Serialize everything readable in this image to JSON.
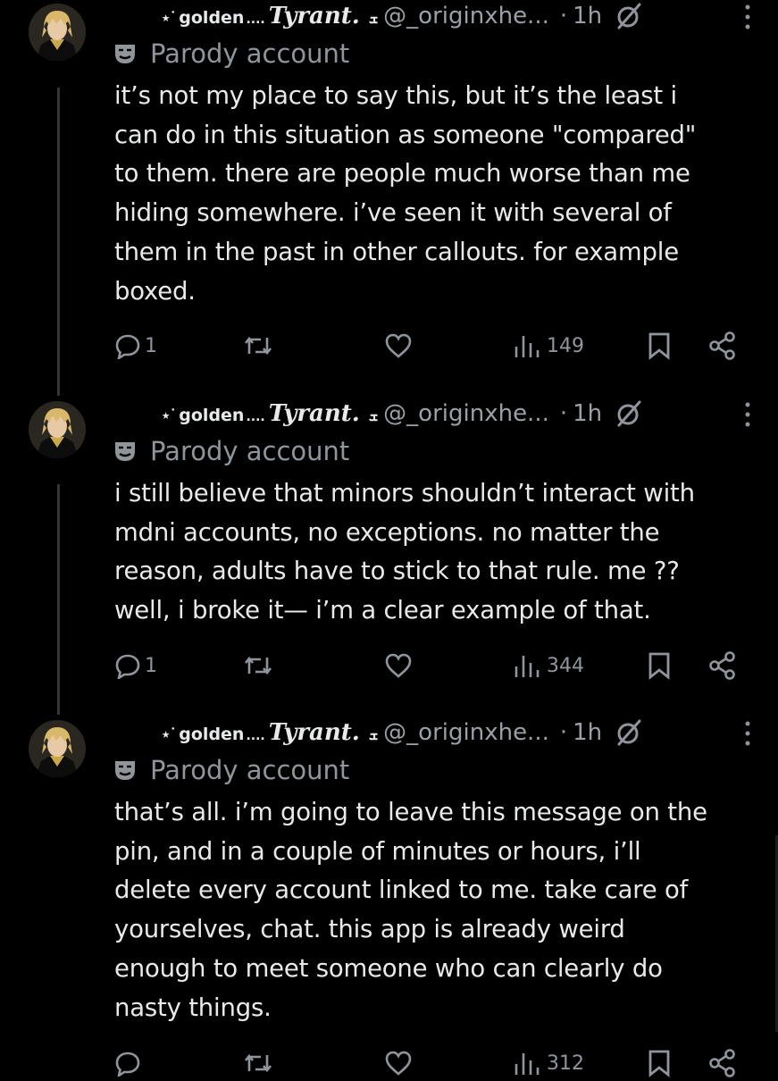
{
  "tweets": [
    {
      "display_name": {
        "sparkle": "⋆˙",
        "word": "golden",
        "dots": "....",
        "tyrant": "Tyrant.",
        "mini": "ܫ"
      },
      "handle": "@_originxhe...",
      "separator": "·",
      "time": "1h",
      "parody_label": "Parody account",
      "text": "it’s not my place to say this, but it’s the least i\ncan do in this situation as someone \"compared\"\nto them. there are people much worse than me\nhiding somewhere. i’ve seen it with several of\nthem in the past in other callouts. for example\nboxed.",
      "replies": "1",
      "views": "149"
    },
    {
      "display_name": {
        "sparkle": "⋆˙",
        "word": "golden",
        "dots": "....",
        "tyrant": "Tyrant.",
        "mini": "ܫ"
      },
      "handle": "@_originxhe...",
      "separator": "·",
      "time": "1h",
      "parody_label": "Parody account",
      "text": "i still believe that minors shouldn’t interact with\nmdni accounts, no exceptions. no matter the\nreason, adults have to stick to that rule. me ??\nwell, i broke it— i’m a clear example of that.",
      "replies": "1",
      "views": "344"
    },
    {
      "display_name": {
        "sparkle": "⋆˙",
        "word": "golden",
        "dots": "....",
        "tyrant": "Tyrant.",
        "mini": "ܫ"
      },
      "handle": "@_originxhe...",
      "separator": "·",
      "time": "1h",
      "parody_label": "Parody account",
      "text": "that’s all. i’m going to leave this message on the\npin, and in a couple of minutes or hours, i’ll\ndelete every account linked to me. take care of\nyourselves, chat. this app is already weird\nenough to meet someone who can clearly do\nnasty things.",
      "replies": "",
      "views": "312"
    }
  ],
  "icons": {
    "reply": "reply-icon",
    "retweet": "retweet-icon",
    "like": "like-icon",
    "views": "views-icon",
    "bookmark": "bookmark-icon",
    "share": "share-icon",
    "more": "more-icon",
    "parody": "parody-mask-icon",
    "status": "null-status-icon"
  },
  "colors": {
    "background": "#000000",
    "text": "#e7e9ea",
    "muted": "#8f959b",
    "thread_line": "#333639"
  }
}
